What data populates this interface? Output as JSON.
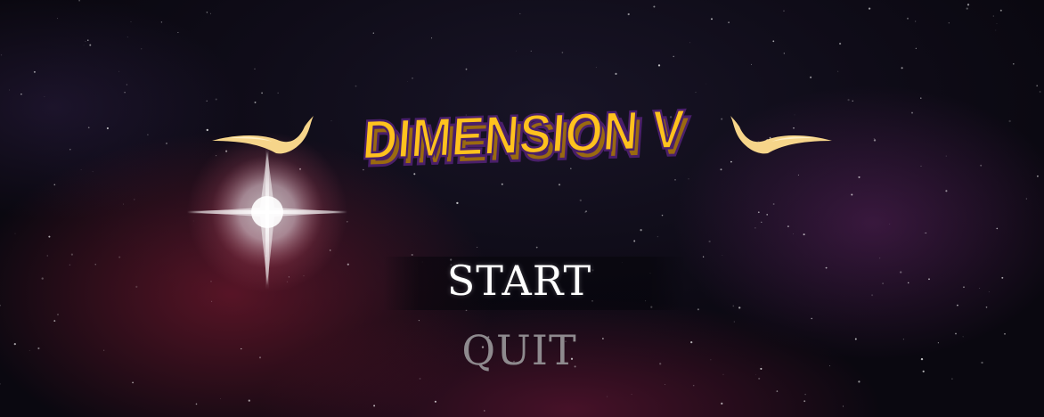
{
  "game": {
    "title": "DIMENSION V"
  },
  "menu": {
    "items": [
      {
        "label": "START",
        "state": "selected"
      },
      {
        "label": "QUIT",
        "state": "normal"
      }
    ]
  },
  "colors": {
    "title_fill": "#ffc21e",
    "title_shadow": "#9a6a10",
    "title_outline": "#4a1f6a",
    "wing_color": "#f6d58a",
    "menu_selected": "#ffffff",
    "menu_normal": "#8e8a8e"
  },
  "icons": {
    "wings": "ornament-wing-icon",
    "flare": "star-flare-icon"
  }
}
